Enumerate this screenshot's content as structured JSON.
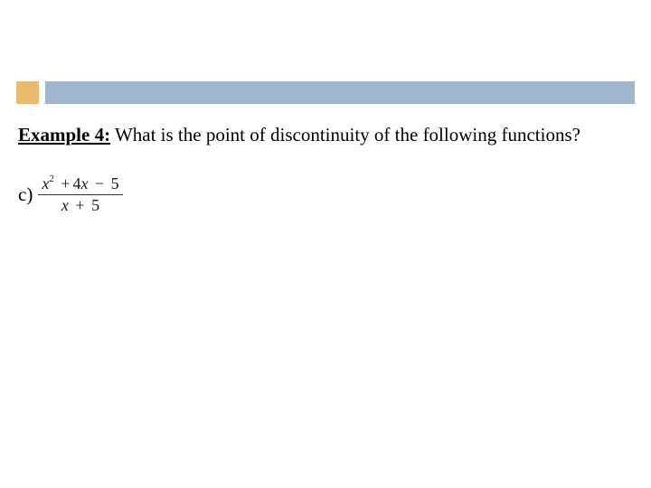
{
  "header": {
    "accent_color": "#e9b96e",
    "bar_color": "#9fb6cd"
  },
  "content": {
    "example_label": "Example 4:",
    "question": " What is the point of discontinuity of the following functions?",
    "part_label": "c)",
    "fraction": {
      "num_var1": "x",
      "num_exp": "2",
      "num_op1": "+",
      "num_coef": "4",
      "num_var2": "x",
      "num_op2": "−",
      "num_const": "5",
      "den_var": "x",
      "den_op": "+",
      "den_const": "5"
    }
  }
}
